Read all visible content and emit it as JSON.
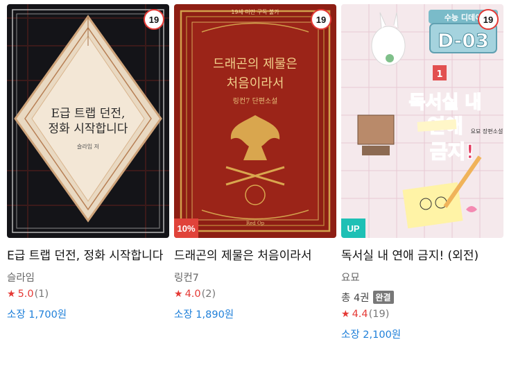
{
  "books": [
    {
      "title": "E급 트랩 던전, 정화 시작합니다",
      "author": "슬라임",
      "age_badge": "19",
      "corner_badge": "",
      "volumes": "",
      "status_badge": "",
      "rating": "5.0",
      "rating_count": "(1)",
      "price": "소장 1,700원",
      "cover_text": [
        "E급 트랩 던전,",
        "정화 시작합니다",
        "슬라임 저"
      ]
    },
    {
      "title": "드래곤의 제물은 처음이라서",
      "author": "링컨7",
      "age_badge": "19",
      "corner_badge": "10%",
      "volumes": "",
      "status_badge": "",
      "rating": "4.0",
      "rating_count": "(2)",
      "price": "소장 1,890원",
      "cover_text": [
        "드래곤의 제물은",
        "처음이라서",
        "링컨7 단편소설",
        "19세 미만 구독 불가",
        "Red Op"
      ]
    },
    {
      "title": "독서실 내 연애 금지! (외전)",
      "author": "요묘",
      "age_badge": "19",
      "corner_badge": "UP",
      "volumes": "총 4권",
      "status_badge": "완결",
      "rating": "4.4",
      "rating_count": "(19)",
      "price": "소장 2,100원",
      "cover_text": [
        "수능 디데이",
        "D-03",
        "독서실 내",
        "연애",
        "금지!",
        "요묘 장편소설",
        "1"
      ]
    }
  ]
}
